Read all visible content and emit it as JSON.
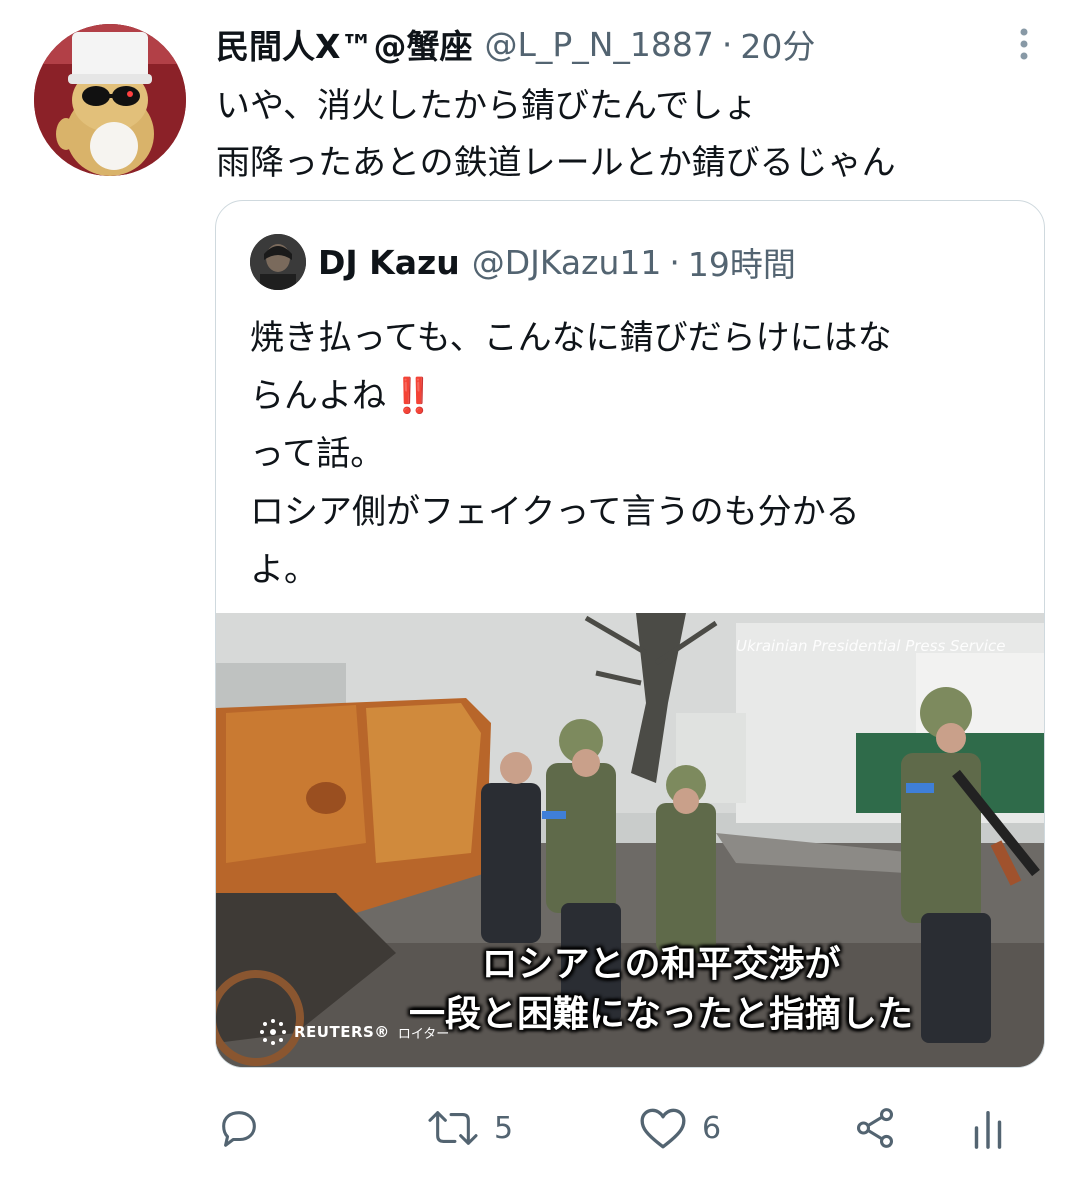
{
  "tweet": {
    "author_name": "民間人X™@蟹座",
    "author_handle": "@L_P_N_1887",
    "separator": "·",
    "time": "20分",
    "text_lines": [
      "いや、消火したから錆びたんでしょ",
      "雨降ったあとの鉄道レールとか錆びるじゃん"
    ]
  },
  "quote": {
    "author_name": "DJ Kazu",
    "author_handle": "@DJKazu11",
    "separator": "·",
    "time": "19時間",
    "text_lines": [
      "焼き払っても、こんなに錆びだらけにはな",
      "らんよね",
      "って話。",
      "ロシア側がフェイクって言うのも分かる",
      "よ。"
    ],
    "emphasis": "‼️",
    "media": {
      "subtitle_line1": "ロシアとの和平交渉が",
      "subtitle_line2": "一段と困難になったと指摘した",
      "watermark": "Ukrainian Presidential Press Service",
      "source_brand": "REUTERS®",
      "source_jp": "ロイター"
    }
  },
  "actions": {
    "reply_icon": "reply-icon",
    "retweet_icon": "retweet-icon",
    "retweet_count": "5",
    "like_icon": "heart-icon",
    "like_count": "6",
    "share_icon": "share-icon",
    "analytics_icon": "analytics-icon"
  },
  "colors": {
    "text": "#0f1419",
    "secondary": "#536471",
    "border": "#cfd9de",
    "emphasis": "#e0245e"
  }
}
